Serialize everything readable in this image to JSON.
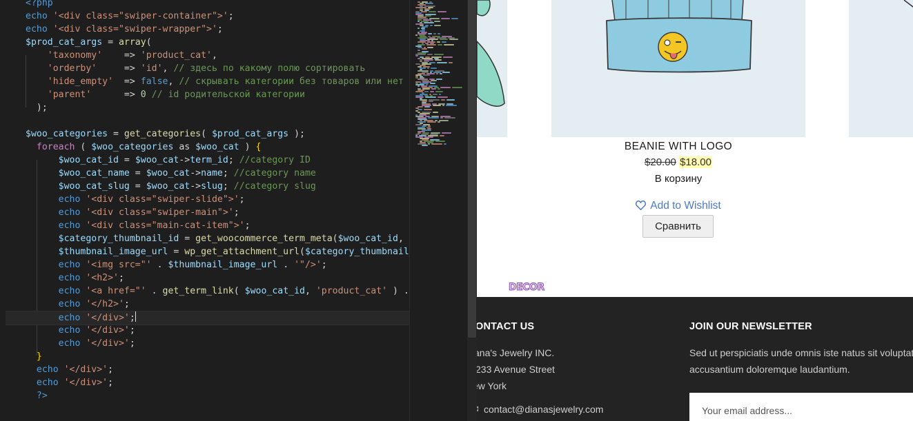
{
  "editor": {
    "lines": [
      [
        [
          "tag",
          "<?php"
        ]
      ],
      [
        [
          "kw",
          "echo "
        ],
        [
          "str",
          "'<div class=\"swiper-container\">'"
        ],
        [
          "op",
          ";"
        ]
      ],
      [
        [
          "kw",
          "echo "
        ],
        [
          "str",
          "'<div class=\"swiper-wrapper\">'"
        ],
        [
          "op",
          ";"
        ]
      ],
      [
        [
          "var",
          "$prod_cat_args"
        ],
        [
          "op",
          " = "
        ],
        [
          "fn",
          "array"
        ],
        [
          "op",
          "("
        ]
      ],
      [
        [
          "op",
          "    "
        ],
        [
          "str",
          "'taxonomy'"
        ],
        [
          "op",
          "    => "
        ],
        [
          "str",
          "'product_cat'"
        ],
        [
          "op",
          ","
        ]
      ],
      [
        [
          "op",
          "    "
        ],
        [
          "str",
          "'orderby'"
        ],
        [
          "op",
          "     => "
        ],
        [
          "str",
          "'id'"
        ],
        [
          "op",
          ", "
        ],
        [
          "com",
          "// здесь по какому полю сортировать"
        ]
      ],
      [
        [
          "op",
          "    "
        ],
        [
          "str",
          "'hide_empty'"
        ],
        [
          "op",
          "  => "
        ],
        [
          "kw",
          "false"
        ],
        [
          "op",
          ", "
        ],
        [
          "com",
          "// скрывать категории без товаров или нет"
        ]
      ],
      [
        [
          "op",
          "    "
        ],
        [
          "str",
          "'parent'"
        ],
        [
          "op",
          "      => "
        ],
        [
          "num",
          "0"
        ],
        [
          "op",
          " "
        ],
        [
          "com",
          "// id родительской категории"
        ]
      ],
      [
        [
          "op",
          "  );"
        ]
      ],
      [],
      [
        [
          "var",
          "$woo_categories"
        ],
        [
          "op",
          " = "
        ],
        [
          "fn",
          "get_categories"
        ],
        [
          "op",
          "( "
        ],
        [
          "var",
          "$prod_cat_args"
        ],
        [
          "op",
          " );"
        ]
      ],
      [
        [
          "op",
          "  "
        ],
        [
          "ctl",
          "foreach"
        ],
        [
          "op",
          " ( "
        ],
        [
          "var",
          "$woo_categories"
        ],
        [
          "op",
          " as "
        ],
        [
          "var",
          "$woo_cat"
        ],
        [
          "op",
          " ) "
        ],
        [
          "brk",
          "{"
        ]
      ],
      [
        [
          "op",
          "      "
        ],
        [
          "var",
          "$woo_cat_id"
        ],
        [
          "op",
          " = "
        ],
        [
          "var",
          "$woo_cat"
        ],
        [
          "op",
          "->"
        ],
        [
          "var",
          "term_id"
        ],
        [
          "op",
          "; "
        ],
        [
          "com",
          "//category ID"
        ]
      ],
      [
        [
          "op",
          "      "
        ],
        [
          "var",
          "$woo_cat_name"
        ],
        [
          "op",
          " = "
        ],
        [
          "var",
          "$woo_cat"
        ],
        [
          "op",
          "->"
        ],
        [
          "var",
          "name"
        ],
        [
          "op",
          "; "
        ],
        [
          "com",
          "//category name"
        ]
      ],
      [
        [
          "op",
          "      "
        ],
        [
          "var",
          "$woo_cat_slug"
        ],
        [
          "op",
          " = "
        ],
        [
          "var",
          "$woo_cat"
        ],
        [
          "op",
          "->"
        ],
        [
          "var",
          "slug"
        ],
        [
          "op",
          "; "
        ],
        [
          "com",
          "//category slug"
        ]
      ],
      [
        [
          "op",
          "      "
        ],
        [
          "kw",
          "echo "
        ],
        [
          "str",
          "'<div class=\"swiper-slide\">'"
        ],
        [
          "op",
          ";"
        ]
      ],
      [
        [
          "op",
          "      "
        ],
        [
          "kw",
          "echo "
        ],
        [
          "str",
          "'<div class=\"swiper-main\">'"
        ],
        [
          "op",
          ";"
        ]
      ],
      [
        [
          "op",
          "      "
        ],
        [
          "kw",
          "echo "
        ],
        [
          "str",
          "'<div class=\"main-cat-item\">'"
        ],
        [
          "op",
          ";"
        ]
      ],
      [
        [
          "op",
          "      "
        ],
        [
          "var",
          "$category_thumbnail_id"
        ],
        [
          "op",
          " = "
        ],
        [
          "fn",
          "get_woocommerce_term_meta"
        ],
        [
          "op",
          "("
        ],
        [
          "var",
          "$woo_cat_id"
        ],
        [
          "op",
          ", "
        ],
        [
          "str",
          "'th"
        ]
      ],
      [
        [
          "op",
          "      "
        ],
        [
          "var",
          "$thumbnail_image_url"
        ],
        [
          "op",
          " = "
        ],
        [
          "fn",
          "wp_get_attachment_url"
        ],
        [
          "op",
          "("
        ],
        [
          "var",
          "$category_thumbnail_id"
        ]
      ],
      [
        [
          "op",
          "      "
        ],
        [
          "kw",
          "echo "
        ],
        [
          "str",
          "'<img src=\"'"
        ],
        [
          "op",
          " . "
        ],
        [
          "var",
          "$thumbnail_image_url"
        ],
        [
          "op",
          " . "
        ],
        [
          "str",
          "'\"/>'"
        ],
        [
          "op",
          ";"
        ]
      ],
      [
        [
          "op",
          "      "
        ],
        [
          "kw",
          "echo "
        ],
        [
          "str",
          "'<h2>'"
        ],
        [
          "op",
          ";"
        ]
      ],
      [
        [
          "op",
          "      "
        ],
        [
          "kw",
          "echo "
        ],
        [
          "str",
          "'<a href=\"'"
        ],
        [
          "op",
          " . "
        ],
        [
          "fn",
          "get_term_link"
        ],
        [
          "op",
          "( "
        ],
        [
          "var",
          "$woo_cat_id"
        ],
        [
          "op",
          ", "
        ],
        [
          "str",
          "'product_cat'"
        ],
        [
          "op",
          " ) . "
        ],
        [
          "str",
          "'"
        ]
      ],
      [
        [
          "op",
          "      "
        ],
        [
          "kw",
          "echo "
        ],
        [
          "str",
          "'</h2>'"
        ],
        [
          "op",
          ";"
        ]
      ],
      [
        [
          "op",
          "      "
        ],
        [
          "kw",
          "echo "
        ],
        [
          "str",
          "'</div>'"
        ],
        [
          "op",
          ";"
        ]
      ],
      [
        [
          "op",
          "      "
        ],
        [
          "kw",
          "echo "
        ],
        [
          "str",
          "'</div>'"
        ],
        [
          "op",
          ";"
        ]
      ],
      [
        [
          "op",
          "      "
        ],
        [
          "kw",
          "echo "
        ],
        [
          "str",
          "'</div>'"
        ],
        [
          "op",
          ";"
        ]
      ],
      [
        [
          "op",
          "  "
        ],
        [
          "brk",
          "}"
        ]
      ],
      [
        [
          "op",
          "  "
        ],
        [
          "kw",
          "echo "
        ],
        [
          "str",
          "'</div>'"
        ],
        [
          "op",
          ";"
        ]
      ],
      [
        [
          "op",
          "  "
        ],
        [
          "kw",
          "echo "
        ],
        [
          "str",
          "'</div>'"
        ],
        [
          "op",
          ";"
        ]
      ],
      [
        [
          "op",
          "  "
        ],
        [
          "tag",
          "?>"
        ]
      ]
    ],
    "current_line": 24
  },
  "product": {
    "title": "BEANIE WITH LOGO",
    "old_price": "$20.00",
    "new_price": "$18.00",
    "add_to_cart": "В корзину",
    "wishlist": "Add to Wishlist",
    "compare": "Сравнить"
  },
  "logo_text": "DECOR",
  "footer": {
    "contact_heading": "ONTACT US",
    "contact_lines": [
      "ana's Jewelry INC.",
      "233 Avenue Street",
      "ew York"
    ],
    "contact_email": "contact@dianasjewelry.com",
    "newsletter_heading": "JOIN OUR NEWSLETTER",
    "newsletter_text_1": "Sed ut perspiciatis unde omnis iste natus sit voluptat",
    "newsletter_text_2": "accusantium doloremque laudantium.",
    "email_placeholder": "Your email address..."
  },
  "colors": {
    "editor_bg": "#1e1e1e",
    "footer_bg": "#232323",
    "link_blue": "#4a7ac6",
    "sale_highlight": "#fffaaf"
  }
}
